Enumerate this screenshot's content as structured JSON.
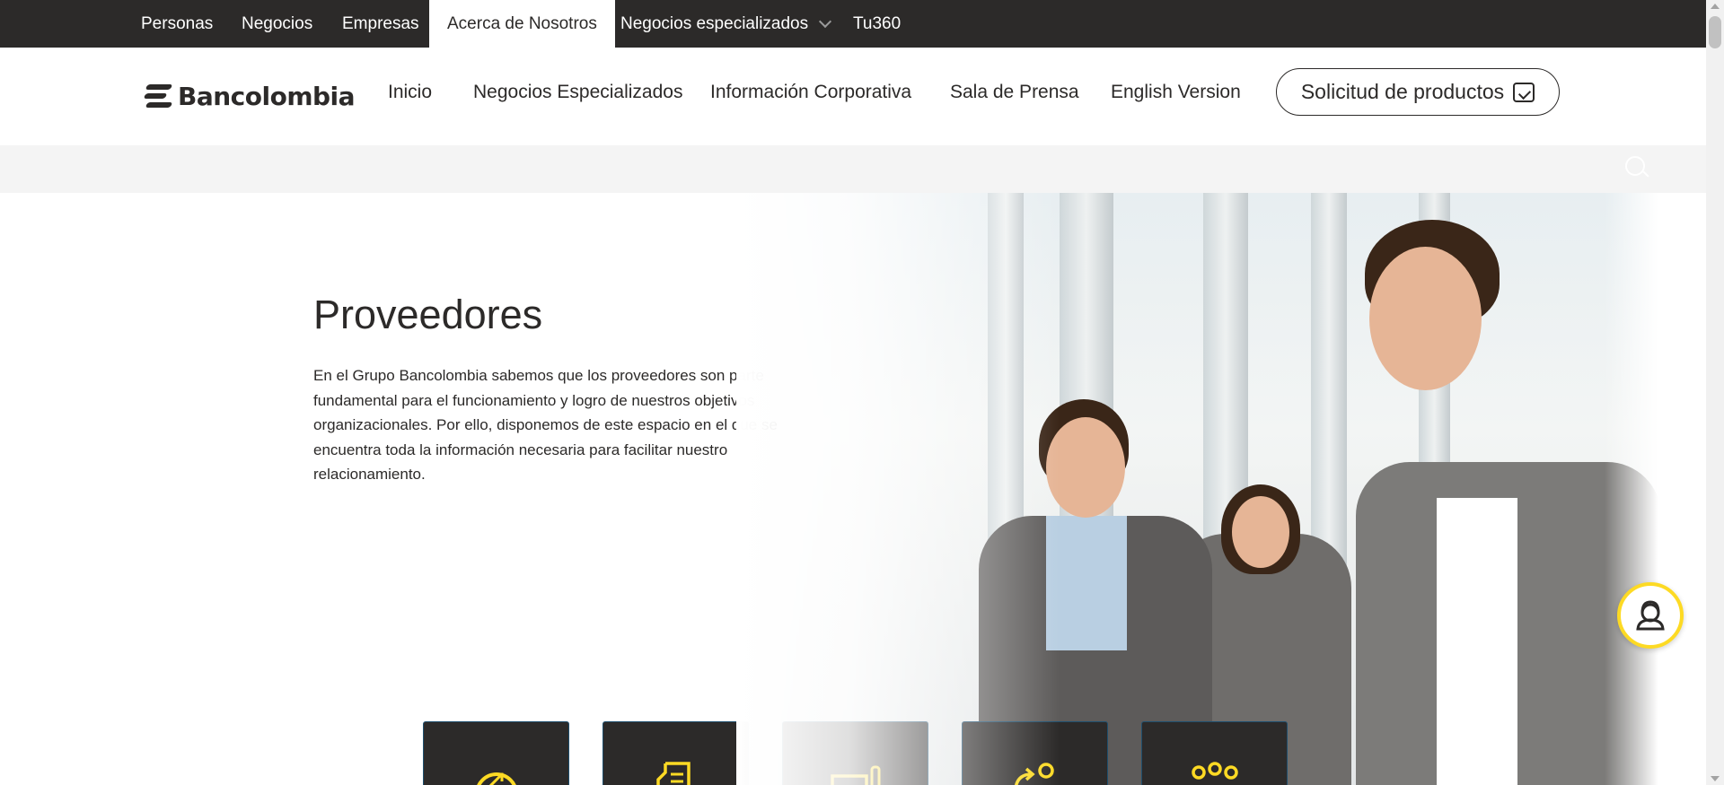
{
  "segments": [
    {
      "label": "Personas",
      "active": false
    },
    {
      "label": "Negocios",
      "active": false
    },
    {
      "label": "Empresas",
      "active": false
    },
    {
      "label": "Acerca de Nosotros",
      "active": true
    },
    {
      "label": "Negocios especializados",
      "active": false,
      "dropdown": true
    },
    {
      "label": "Tu360",
      "active": false
    }
  ],
  "brand": {
    "name": "Bancolombia"
  },
  "nav": {
    "items": [
      "Inicio",
      "Negocios Especializados",
      "Información Corporativa",
      "Sala de Prensa",
      "English Version"
    ],
    "cta_label": "Solicitud de productos"
  },
  "hero": {
    "title": "Proveedores",
    "text": "En el Grupo Bancolombia sabemos que los proveedores son parte fundamental para el funcionamiento y logro de nuestros objetivos organizacionales. Por ello, disponemos de este espacio en el que se encuentra toda la información necesaria para facilitar nuestro relacionamiento."
  },
  "cards": [
    {
      "icon": "chart-arrow-icon"
    },
    {
      "icon": "receipt-icon"
    },
    {
      "icon": "laptop-icon"
    },
    {
      "icon": "user-transfer-icon"
    },
    {
      "icon": "people-group-icon"
    }
  ],
  "colors": {
    "dark": "#2c2a29",
    "accent": "#fdda24",
    "strip": "#f4f4f4"
  },
  "chat": {
    "icon": "chat-agent-icon"
  }
}
